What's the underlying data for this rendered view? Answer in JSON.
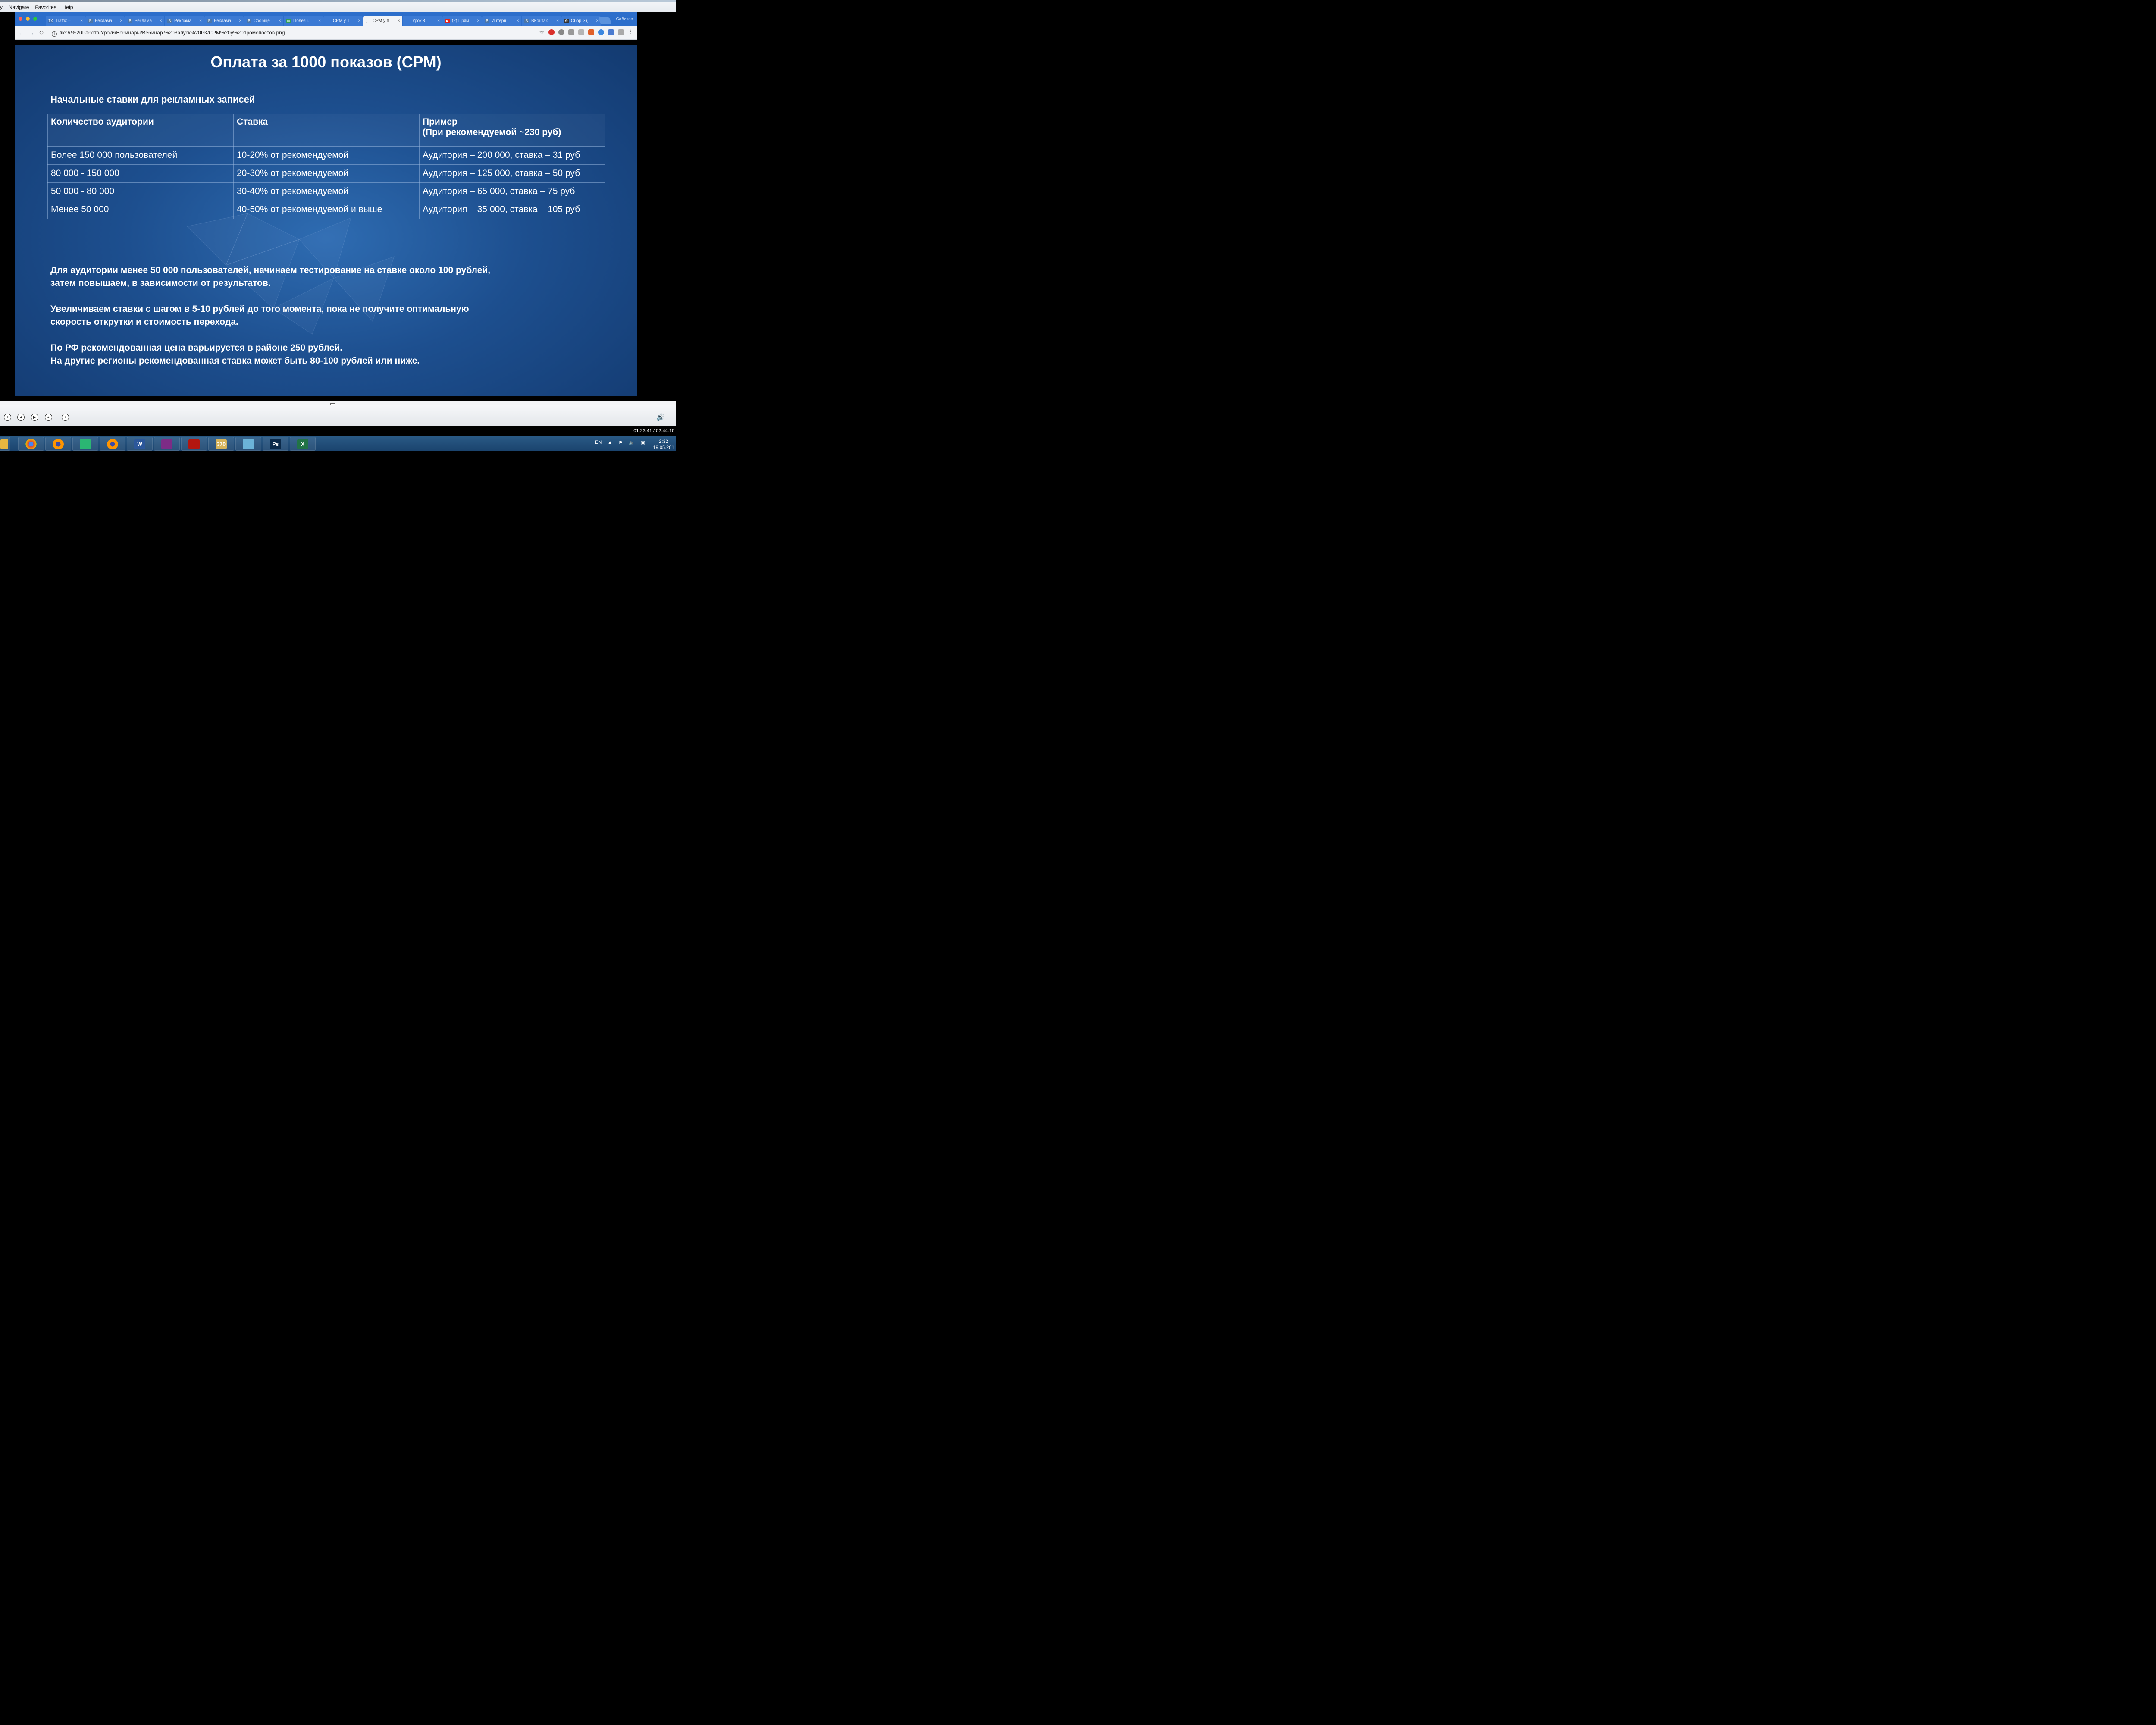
{
  "player_menu": {
    "items": [
      "y",
      "Navigate",
      "Favorites",
      "Help"
    ]
  },
  "browser": {
    "tabs": [
      {
        "label": "Traffix –",
        "icon": "tx-icon",
        "icon_text": "TX"
      },
      {
        "label": "Реклама",
        "icon": "vk-icon",
        "icon_text": "В"
      },
      {
        "label": "Реклама",
        "icon": "vk-icon",
        "icon_text": "В"
      },
      {
        "label": "Реклама",
        "icon": "vk-icon",
        "icon_text": "В"
      },
      {
        "label": "Реклама",
        "icon": "vk-icon",
        "icon_text": "В"
      },
      {
        "label": "Сообще",
        "icon": "vk-icon",
        "icon_text": "В"
      },
      {
        "label": "Полезн.",
        "icon": "sheet-icon",
        "icon_text": "▤"
      },
      {
        "label": "CPM у Т",
        "icon": "page-icon",
        "icon_text": ""
      },
      {
        "label": "CPM у п",
        "icon": "page-icon",
        "icon_text": "",
        "active": true
      },
      {
        "label": "Урок 8",
        "icon": "page-icon",
        "icon_text": ""
      },
      {
        "label": "(2) Прям",
        "icon": "youtube-icon",
        "icon_text": "▶"
      },
      {
        "label": "Интерн",
        "icon": "vk-icon",
        "icon_text": "В"
      },
      {
        "label": "ВКонтак",
        "icon": "vk-icon",
        "icon_text": "В"
      },
      {
        "label": "Сбор > (",
        "icon": "gear-icon",
        "icon_text": "⚙"
      }
    ],
    "profile": "Сабитов",
    "url": "file:///%20Работа/Уроки/Вебинары/Вебинар.%203апуск%20РК/CPM%20y%20промопостов.png",
    "colors": {
      "tabstrip": "#2c6ecb"
    }
  },
  "slide": {
    "title": "Оплата за 1000 показов (CPM)",
    "subtitle": "Начальные ставки для рекламных записей",
    "table": {
      "headers": [
        "Количество аудитории",
        "Ставка",
        "Пример"
      ],
      "header_sub": "(При рекомендуемой ~230 руб)",
      "rows": [
        [
          "Более 150 000 пользователей",
          "10-20% от рекомендуемой",
          "Аудитория – 200 000, ставка – 31 руб"
        ],
        [
          "80 000 - 150 000",
          "20-30% от рекомендуемой",
          "Аудитория – 125 000, ставка – 50 руб"
        ],
        [
          "50 000 - 80 000",
          "30-40% от рекомендуемой",
          "Аудитория – 65 000, ставка – 75 руб"
        ],
        [
          "Менее 50 000",
          "40-50% от рекомендуемой и выше",
          "Аудитория – 35 000, ставка – 105 руб"
        ]
      ]
    },
    "notes": [
      "Для аудитории менее 50 000 пользователей, начинаем тестирование на ставке около 100 рублей,",
      "затем повышаем, в зависимости от результатов.",
      "Увеличиваем ставки с шагом в 5-10 рублей до того момента, пока не получите оптимальную",
      "скорость открутки и стоимость перехода.",
      "По РФ рекомендованная цена варьируется в районе 250 рублей.",
      "На другие регионы рекомендованная ставка может быть 80-100 рублей или ниже."
    ]
  },
  "player": {
    "time": "01:23:41 / 02:44:16",
    "progress_fraction": 0.51
  },
  "taskbar": {
    "apps": [
      {
        "name": "chrome-icon",
        "label": ""
      },
      {
        "name": "firefox-icon",
        "label": ""
      },
      {
        "name": "network-app-icon",
        "label": ""
      },
      {
        "name": "firefox-icon",
        "label": ""
      },
      {
        "name": "word-icon",
        "label": "W"
      },
      {
        "name": "winrar-icon",
        "label": ""
      },
      {
        "name": "acrobat-icon",
        "label": ""
      },
      {
        "name": "video-editor-icon",
        "label": "370"
      },
      {
        "name": "notepad-icon",
        "label": ""
      },
      {
        "name": "photoshop-icon",
        "label": "Ps"
      },
      {
        "name": "excel-icon",
        "label": "X"
      }
    ],
    "lang": "EN",
    "time": "2:32",
    "date": "19.05.201"
  }
}
